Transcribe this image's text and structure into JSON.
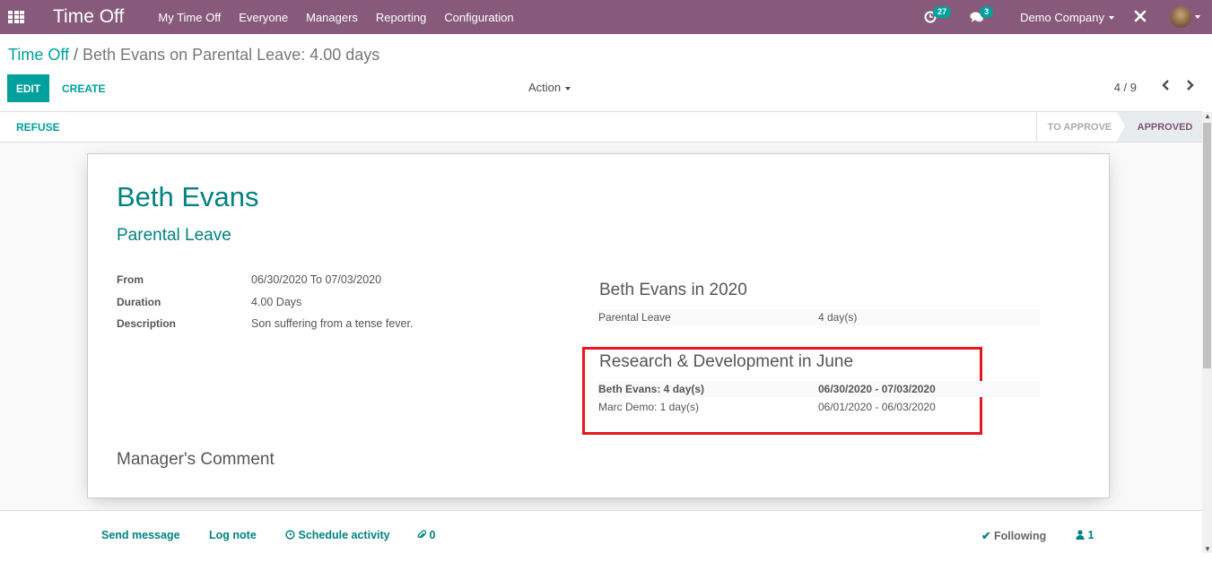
{
  "navbar": {
    "app_title": "Time Off",
    "menu": [
      "My Time Off",
      "Everyone",
      "Managers",
      "Reporting",
      "Configuration"
    ],
    "activity_count": "27",
    "message_count": "3",
    "company": "Demo Company",
    "icons": {
      "apps": "apps-grid-icon",
      "activity": "clock-icon",
      "messages": "chat-bubbles-icon",
      "tools": "wrench-screwdriver-icon",
      "avatar": "user-avatar"
    }
  },
  "breadcrumb": {
    "parent": "Time Off",
    "separator": "/",
    "current": "Beth Evans on Parental Leave: 4.00 days"
  },
  "control_panel": {
    "edit_label": "EDIT",
    "create_label": "CREATE",
    "action_label": "Action",
    "pager": "4 / 9"
  },
  "statusbar": {
    "refuse_label": "REFUSE",
    "stages": [
      {
        "label": "TO APPROVE",
        "active": false
      },
      {
        "label": "APPROVED",
        "active": true
      }
    ]
  },
  "form": {
    "employee": "Beth Evans",
    "leave_type": "Parental Leave",
    "fields": [
      {
        "label": "From",
        "value": "06/30/2020  To  07/03/2020"
      },
      {
        "label": "Duration",
        "value": "4.00  Days"
      },
      {
        "label": "Description",
        "value": "Son suffering from a tense fever."
      }
    ],
    "summary_year": {
      "title": "Beth Evans in 2020",
      "rows": [
        {
          "name": "Parental Leave",
          "value": "4 day(s)"
        }
      ]
    },
    "summary_department": {
      "title": "Research & Development in June",
      "rows": [
        {
          "name": "Beth Evans: 4 day(s)",
          "value": "06/30/2020 - 07/03/2020",
          "bold": true
        },
        {
          "name": "Marc Demo: 1 day(s)",
          "value": "06/01/2020 - 06/03/2020",
          "bold": false
        }
      ]
    },
    "manager_comment_title": "Manager's Comment"
  },
  "chatter": {
    "send_message": "Send message",
    "log_note": "Log note",
    "schedule_activity": "Schedule activity",
    "attachments": "0",
    "following": "Following",
    "followers": "1"
  },
  "colors": {
    "navbar": "#875a7b",
    "primary": "#00a09d",
    "title_teal": "#00837f",
    "highlight_border": "#e8171e",
    "stage_active_text": "#7c5575"
  }
}
